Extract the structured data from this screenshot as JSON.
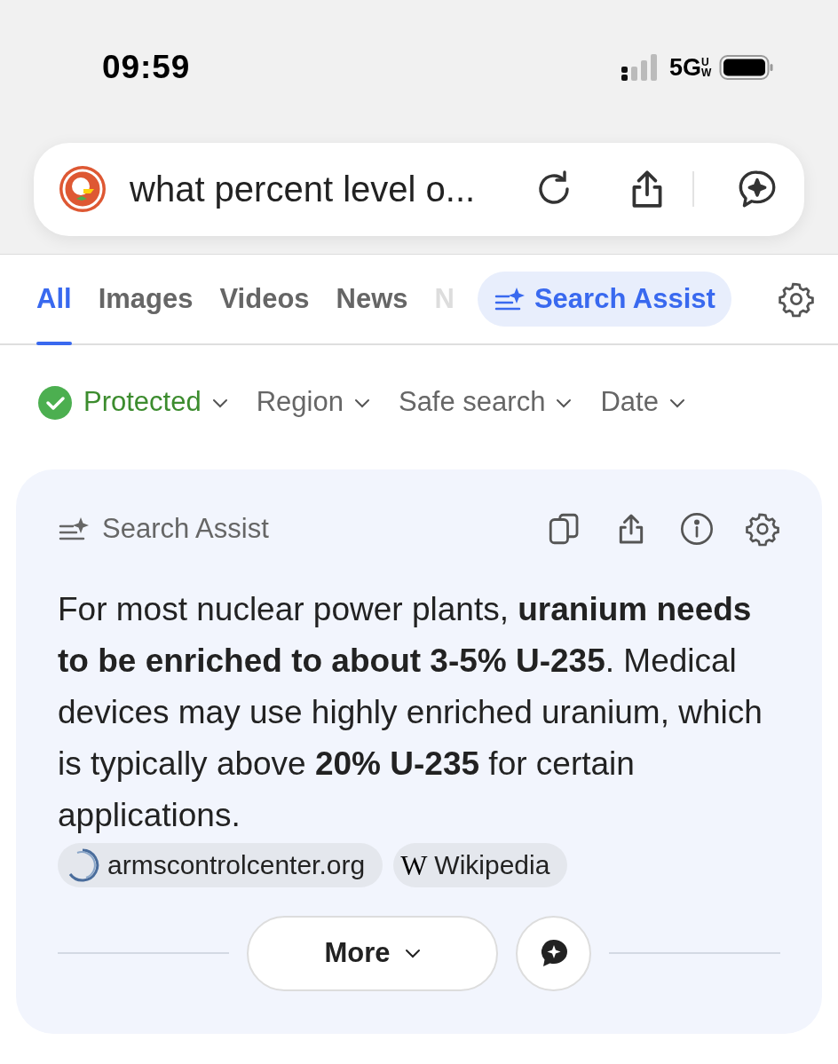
{
  "status_bar": {
    "time": "09:59",
    "network": "5G",
    "network_badge": "UW"
  },
  "address_bar": {
    "query": "what percent level o..."
  },
  "tabs": [
    {
      "label": "All",
      "selected": true,
      "faded": false
    },
    {
      "label": "Images",
      "selected": false,
      "faded": false
    },
    {
      "label": "Videos",
      "selected": false,
      "faded": false
    },
    {
      "label": "News",
      "selected": false,
      "faded": false
    },
    {
      "label": "N",
      "selected": false,
      "faded": true
    }
  ],
  "assist_tab": {
    "label": "Search Assist"
  },
  "filters": [
    {
      "label": "Protected",
      "kind": "protected"
    },
    {
      "label": "Region",
      "kind": "plain"
    },
    {
      "label": "Safe search",
      "kind": "plain"
    },
    {
      "label": "Date",
      "kind": "plain"
    }
  ],
  "assist_card": {
    "title": "Search Assist",
    "answer": "For most nuclear power plants, **uranium needs to be enriched to about 3-5% U-235**. Medical devices may use highly enriched uranium, which is typically above **20% U-235** for certain applications.",
    "sources": [
      {
        "name": "armscontrolcenter.org",
        "kind": "arc"
      },
      {
        "name": "Wikipedia",
        "kind": "letter",
        "glyph": "W"
      }
    ],
    "more_button": "More"
  }
}
